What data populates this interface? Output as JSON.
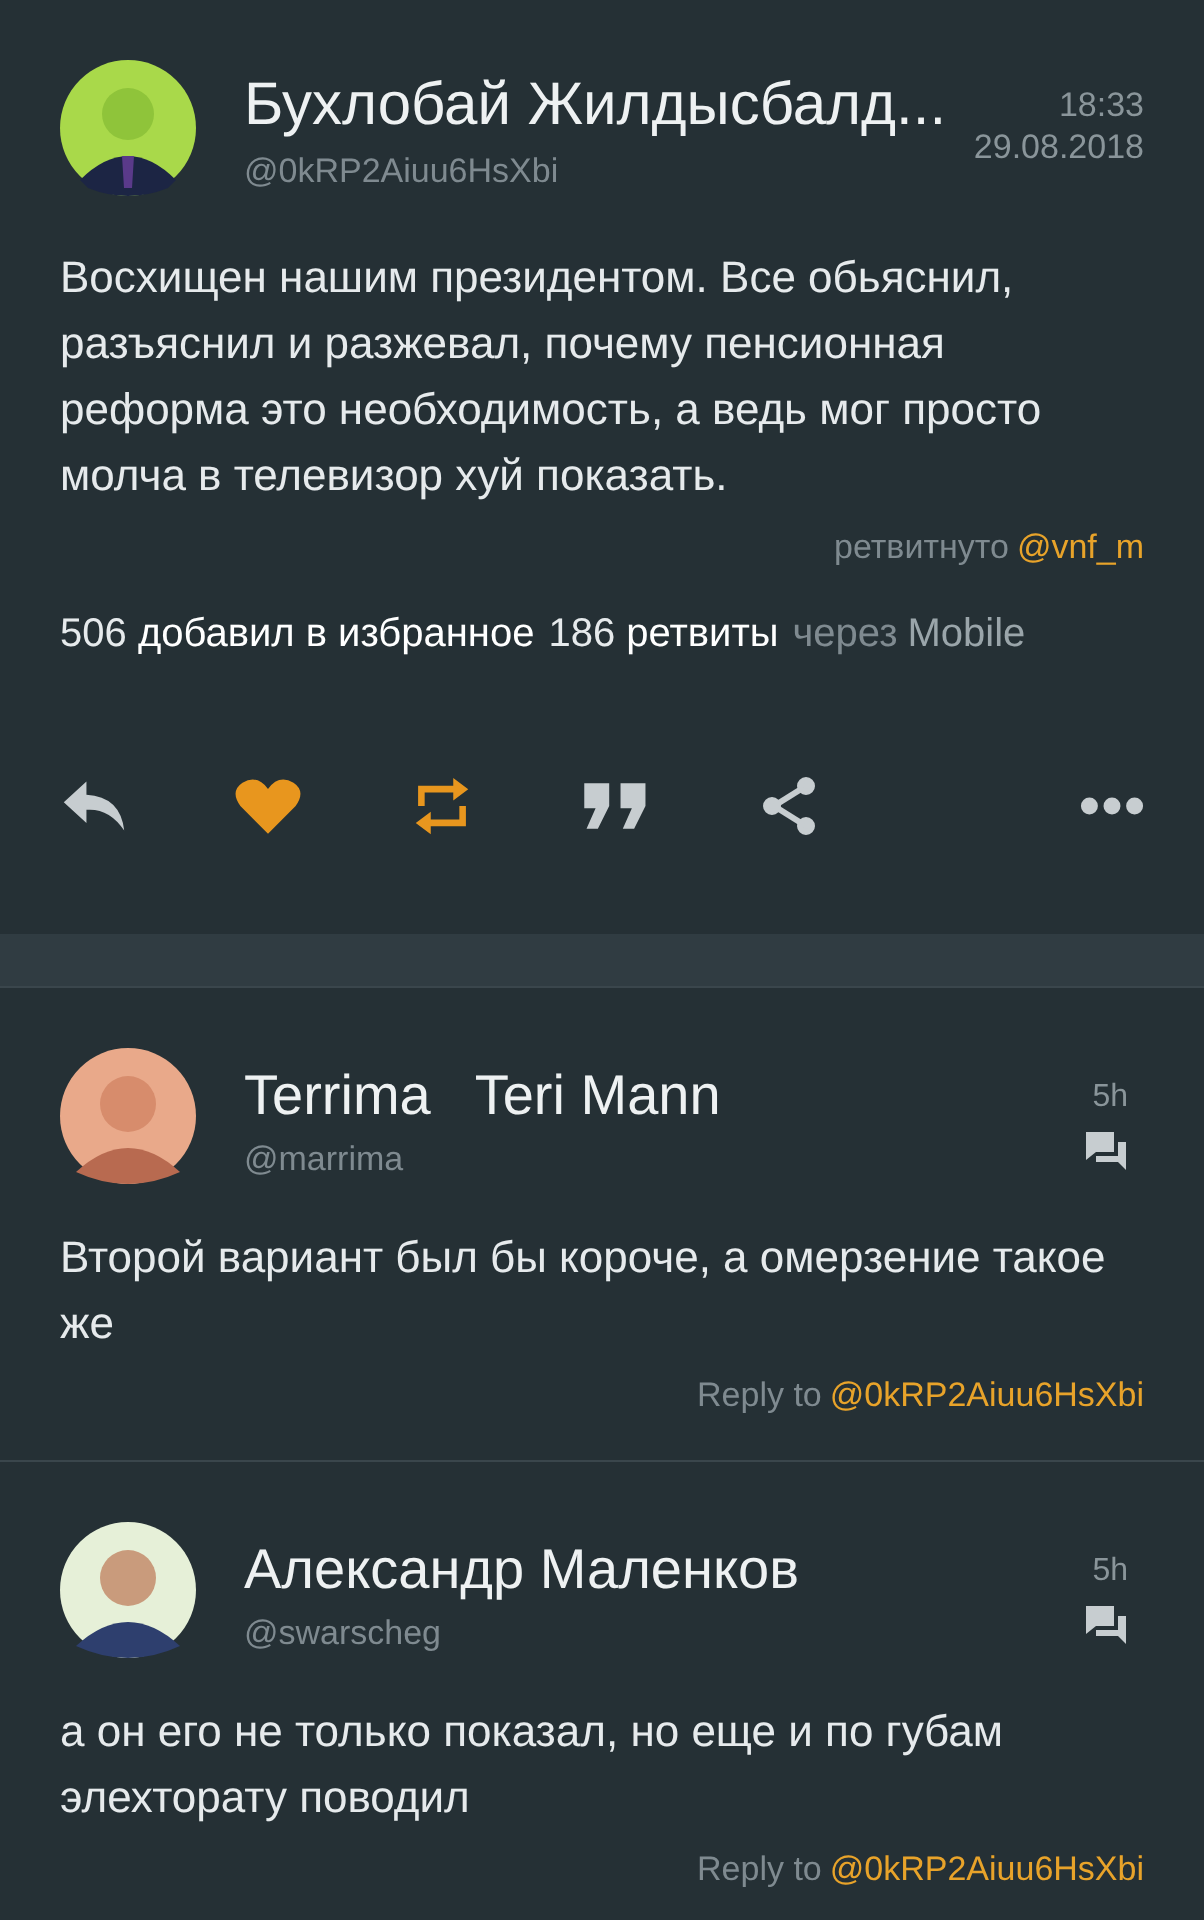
{
  "tweet": {
    "name": "Бухлобай Жилдысбалд...",
    "handle": "@0kRP2Aiuu6HsXbi",
    "time": "18:33",
    "date": "29.08.2018",
    "text": "Восхищен нашим президентом. Все обьяснил, разъяснил и разжевал, почему пенсионная реформа это необходимость, а ведь мог просто молча в телевизор хуй показать.",
    "retweeted_by": {
      "label": "ретвитнуто",
      "user": "@vnf_m"
    },
    "stats": [
      "506 **добавил в избранное**",
      "186 **ретвиты**"
    ],
    "via": {
      "label": "через",
      "source": "Mobile"
    },
    "actions": [
      {
        "kind": "reply",
        "active": false
      },
      {
        "kind": "like",
        "active": true
      },
      {
        "kind": "retweet",
        "active": true
      },
      {
        "kind": "quote",
        "active": false
      },
      {
        "kind": "share",
        "active": false
      },
      {
        "kind": "more",
        "active": false
      }
    ]
  },
  "replies": [
    {
      "name": "Terrima",
      "second_name": "Teri Mann",
      "handle": "@marrima",
      "time": "5h",
      "text": "Второй вариант был бы короче, а омерзение такое же",
      "reply_label": "Reply to",
      "reply_target": "@0kRP2Aiuu6HsXbi"
    },
    {
      "name": "Александр Маленков",
      "handle": "@swarscheg",
      "time": "5h",
      "text": "а он его не только показал, но еще и по губам элехторату поводил",
      "reply_label": "Reply to",
      "reply_target": "@0kRP2Aiuu6HsXbi"
    }
  ]
}
